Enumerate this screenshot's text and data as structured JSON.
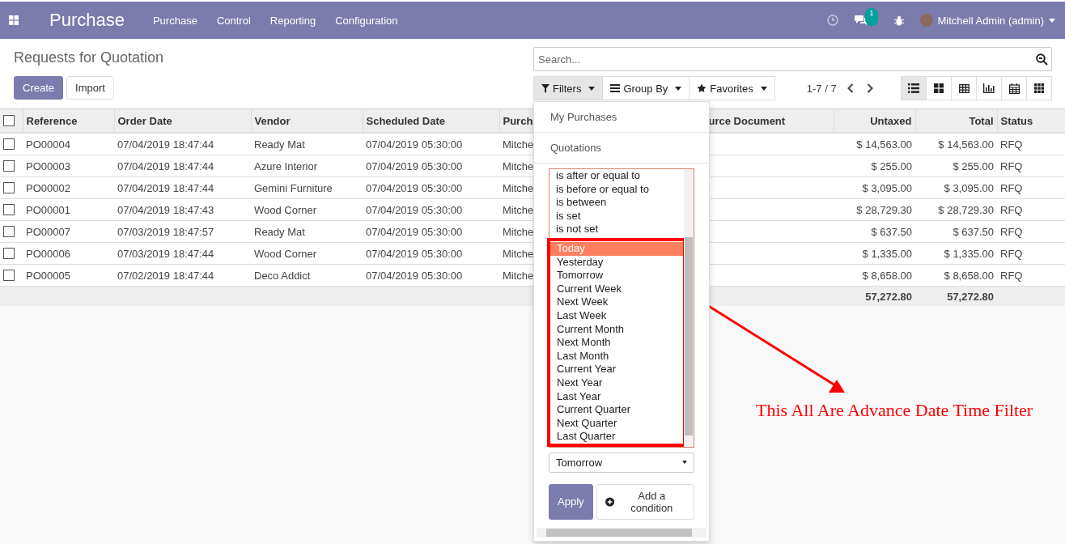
{
  "navbar": {
    "app_title": "Purchase",
    "menu": [
      "Purchase",
      "Control",
      "Reporting",
      "Configuration"
    ],
    "messages_badge": "1",
    "user": "Mitchell Admin (admin)"
  },
  "breadcrumb": "Requests for Quotation",
  "buttons": [
    "Create",
    "Import"
  ],
  "search": {
    "placeholder": "Search..."
  },
  "search_buttons": [
    {
      "label": "Filters",
      "kind": "filter",
      "selected": true
    },
    {
      "label": "Group By",
      "kind": "group",
      "selected": false
    },
    {
      "label": "Favorites",
      "kind": "star",
      "selected": false
    }
  ],
  "pager": "1-7 / 7",
  "view_switcher": [
    {
      "kind": "list",
      "selected": true
    },
    {
      "kind": "kanban",
      "selected": false
    },
    {
      "kind": "pivot",
      "selected": false
    },
    {
      "kind": "graph",
      "selected": false
    },
    {
      "kind": "calendar",
      "selected": false
    },
    {
      "kind": "grid",
      "selected": false
    }
  ],
  "table": {
    "select_all_checked": false,
    "columns": [
      "Reference",
      "Order Date",
      "Vendor",
      "Scheduled Date",
      "Purch",
      "urce Document",
      "Untaxed",
      "Total",
      "Status"
    ],
    "rows": [
      {
        "checked": false,
        "cells": [
          "PO00004",
          "07/04/2019 18:47:44",
          "Ready Mat",
          "07/04/2019 05:30:00",
          "Mitche",
          "",
          "$ 14,563.00",
          "$ 14,563.00",
          "RFQ"
        ]
      },
      {
        "checked": false,
        "cells": [
          "PO00003",
          "07/04/2019 18:47:44",
          "Azure Interior",
          "07/04/2019 05:30:00",
          "Mitche",
          "",
          "$ 255.00",
          "$ 255.00",
          "RFQ"
        ]
      },
      {
        "checked": false,
        "cells": [
          "PO00002",
          "07/04/2019 18:47:44",
          "Gemini Furniture",
          "07/04/2019 05:30:00",
          "Mitche",
          "",
          "$ 3,095.00",
          "$ 3,095.00",
          "RFQ"
        ]
      },
      {
        "checked": false,
        "cells": [
          "PO00001",
          "07/04/2019 18:47:43",
          "Wood Corner",
          "07/04/2019 05:30:00",
          "Mitche",
          "",
          "$ 28,729.30",
          "$ 28,729.30",
          "RFQ"
        ]
      },
      {
        "checked": false,
        "cells": [
          "PO00007",
          "07/03/2019 18:47:57",
          "Ready Mat",
          "07/04/2019 05:30:00",
          "Mitche",
          "",
          "$ 637.50",
          "$ 637.50",
          "RFQ"
        ]
      },
      {
        "checked": false,
        "cells": [
          "PO00006",
          "07/03/2019 18:47:44",
          "Wood Corner",
          "07/04/2019 05:30:00",
          "Mitche",
          "",
          "$ 1,335.00",
          "$ 1,335.00",
          "RFQ"
        ]
      },
      {
        "checked": false,
        "cells": [
          "PO00005",
          "07/02/2019 18:47:44",
          "Deco Addict",
          "07/04/2019 05:30:00",
          "Mitche",
          "",
          "$ 8,658.00",
          "$ 8,658.00",
          "RFQ"
        ]
      }
    ],
    "totals": {
      "untaxed": "57,272.80",
      "total": "57,272.80"
    }
  },
  "filters_menu": {
    "items": [
      "My Purchases",
      "Quotations"
    ],
    "operator_options": [
      {
        "label": "is after or equal to",
        "selected": false
      },
      {
        "label": "is before or equal to",
        "selected": false
      },
      {
        "label": "is between",
        "selected": false
      },
      {
        "label": "is set",
        "selected": false
      },
      {
        "label": "is not set",
        "selected": false
      }
    ],
    "date_options": [
      {
        "label": "Today",
        "selected": true
      },
      {
        "label": "Yesterday",
        "selected": false
      },
      {
        "label": "Tomorrow",
        "selected": false
      },
      {
        "label": "Current Week",
        "selected": false
      },
      {
        "label": "Next Week",
        "selected": false
      },
      {
        "label": "Last Week",
        "selected": false
      },
      {
        "label": "Current Month",
        "selected": false
      },
      {
        "label": "Next Month",
        "selected": false
      },
      {
        "label": "Last Month",
        "selected": false
      },
      {
        "label": "Current Year",
        "selected": false
      },
      {
        "label": "Next Year",
        "selected": false
      },
      {
        "label": "Last Year",
        "selected": false
      },
      {
        "label": "Current Quarter",
        "selected": false
      },
      {
        "label": "Next Quarter",
        "selected": false
      },
      {
        "label": "Last Quarter",
        "selected": false
      }
    ],
    "value_select": "Tomorrow",
    "apply": "Apply",
    "add_condition": "Add a condition"
  },
  "annotation": "This All Are Advance Date Time Filter"
}
